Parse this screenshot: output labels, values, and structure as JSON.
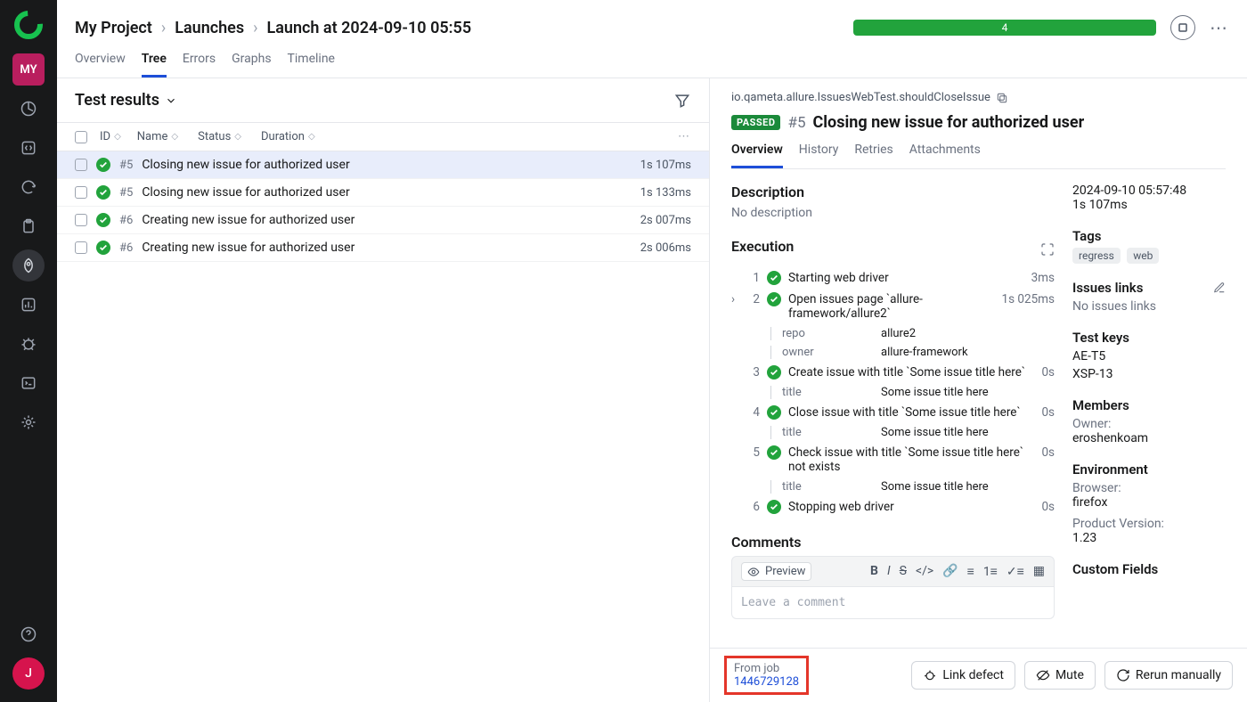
{
  "sidebar": {
    "project_badge": "MY",
    "avatar": "J"
  },
  "breadcrumb": [
    "My Project",
    "Launches",
    "Launch at 2024-09-10 05:55"
  ],
  "progress": {
    "value": "4"
  },
  "tabs": [
    "Overview",
    "Tree",
    "Errors",
    "Graphs",
    "Timeline"
  ],
  "tabs_active": 1,
  "left": {
    "title": "Test results",
    "columns": [
      "ID",
      "Name",
      "Status",
      "Duration"
    ],
    "rows": [
      {
        "id": "#5",
        "name": "Closing new issue for authorized user",
        "duration": "1s 107ms",
        "selected": true
      },
      {
        "id": "#5",
        "name": "Closing new issue for authorized user",
        "duration": "1s 133ms",
        "selected": false
      },
      {
        "id": "#6",
        "name": "Creating new issue for authorized user",
        "duration": "2s 007ms",
        "selected": false
      },
      {
        "id": "#6",
        "name": "Creating new issue for authorized user",
        "duration": "2s 006ms",
        "selected": false
      }
    ]
  },
  "detail": {
    "path": "io.qameta.allure.IssuesWebTest.shouldCloseIssue",
    "status": "PASSED",
    "num": "#5",
    "title": "Closing new issue for authorized user",
    "tabs": [
      "Overview",
      "History",
      "Retries",
      "Attachments"
    ],
    "tabs_active": 0,
    "description_label": "Description",
    "description_value": "No description",
    "execution_label": "Execution",
    "steps": [
      {
        "n": "1",
        "name": "Starting web driver",
        "time": "3ms",
        "params": []
      },
      {
        "n": "2",
        "name": "Open issues page `allure-framework/allure2`",
        "time": "1s 025ms",
        "expandable": true,
        "params": [
          {
            "k": "repo",
            "v": "allure2"
          },
          {
            "k": "owner",
            "v": "allure-framework"
          }
        ]
      },
      {
        "n": "3",
        "name": "Create issue with title `Some issue title here`",
        "time": "0s",
        "params": [
          {
            "k": "title",
            "v": "Some issue title here"
          }
        ]
      },
      {
        "n": "4",
        "name": "Close issue with title `Some issue title here`",
        "time": "0s",
        "params": [
          {
            "k": "title",
            "v": "Some issue title here"
          }
        ]
      },
      {
        "n": "5",
        "name": "Check issue with title `Some issue title here` not exists",
        "time": "0s",
        "params": [
          {
            "k": "title",
            "v": "Some issue title here"
          }
        ]
      },
      {
        "n": "6",
        "name": "Stopping web driver",
        "time": "0s",
        "params": []
      }
    ],
    "comments_label": "Comments",
    "preview_label": "Preview",
    "comment_placeholder": "Leave a comment",
    "meta": {
      "timestamp": "2024-09-10 05:57:48",
      "duration": "1s 107ms",
      "tags_label": "Tags",
      "tags": [
        "regress",
        "web"
      ],
      "issues_label": "Issues links",
      "issues_value": "No issues links",
      "testkeys_label": "Test keys",
      "testkeys": [
        "AE-T5",
        "XSP-13"
      ],
      "members_label": "Members",
      "owner_label": "Owner:",
      "owner_value": "eroshenkoam",
      "env_label": "Environment",
      "env": [
        {
          "k": "Browser:",
          "v": "firefox"
        },
        {
          "k": "Product Version:",
          "v": "1.23"
        }
      ],
      "custom_label": "Custom Fields"
    }
  },
  "footer": {
    "from_job_label": "From job",
    "from_job_id": "1446729128",
    "link_defect": "Link defect",
    "mute": "Mute",
    "rerun": "Rerun manually"
  }
}
